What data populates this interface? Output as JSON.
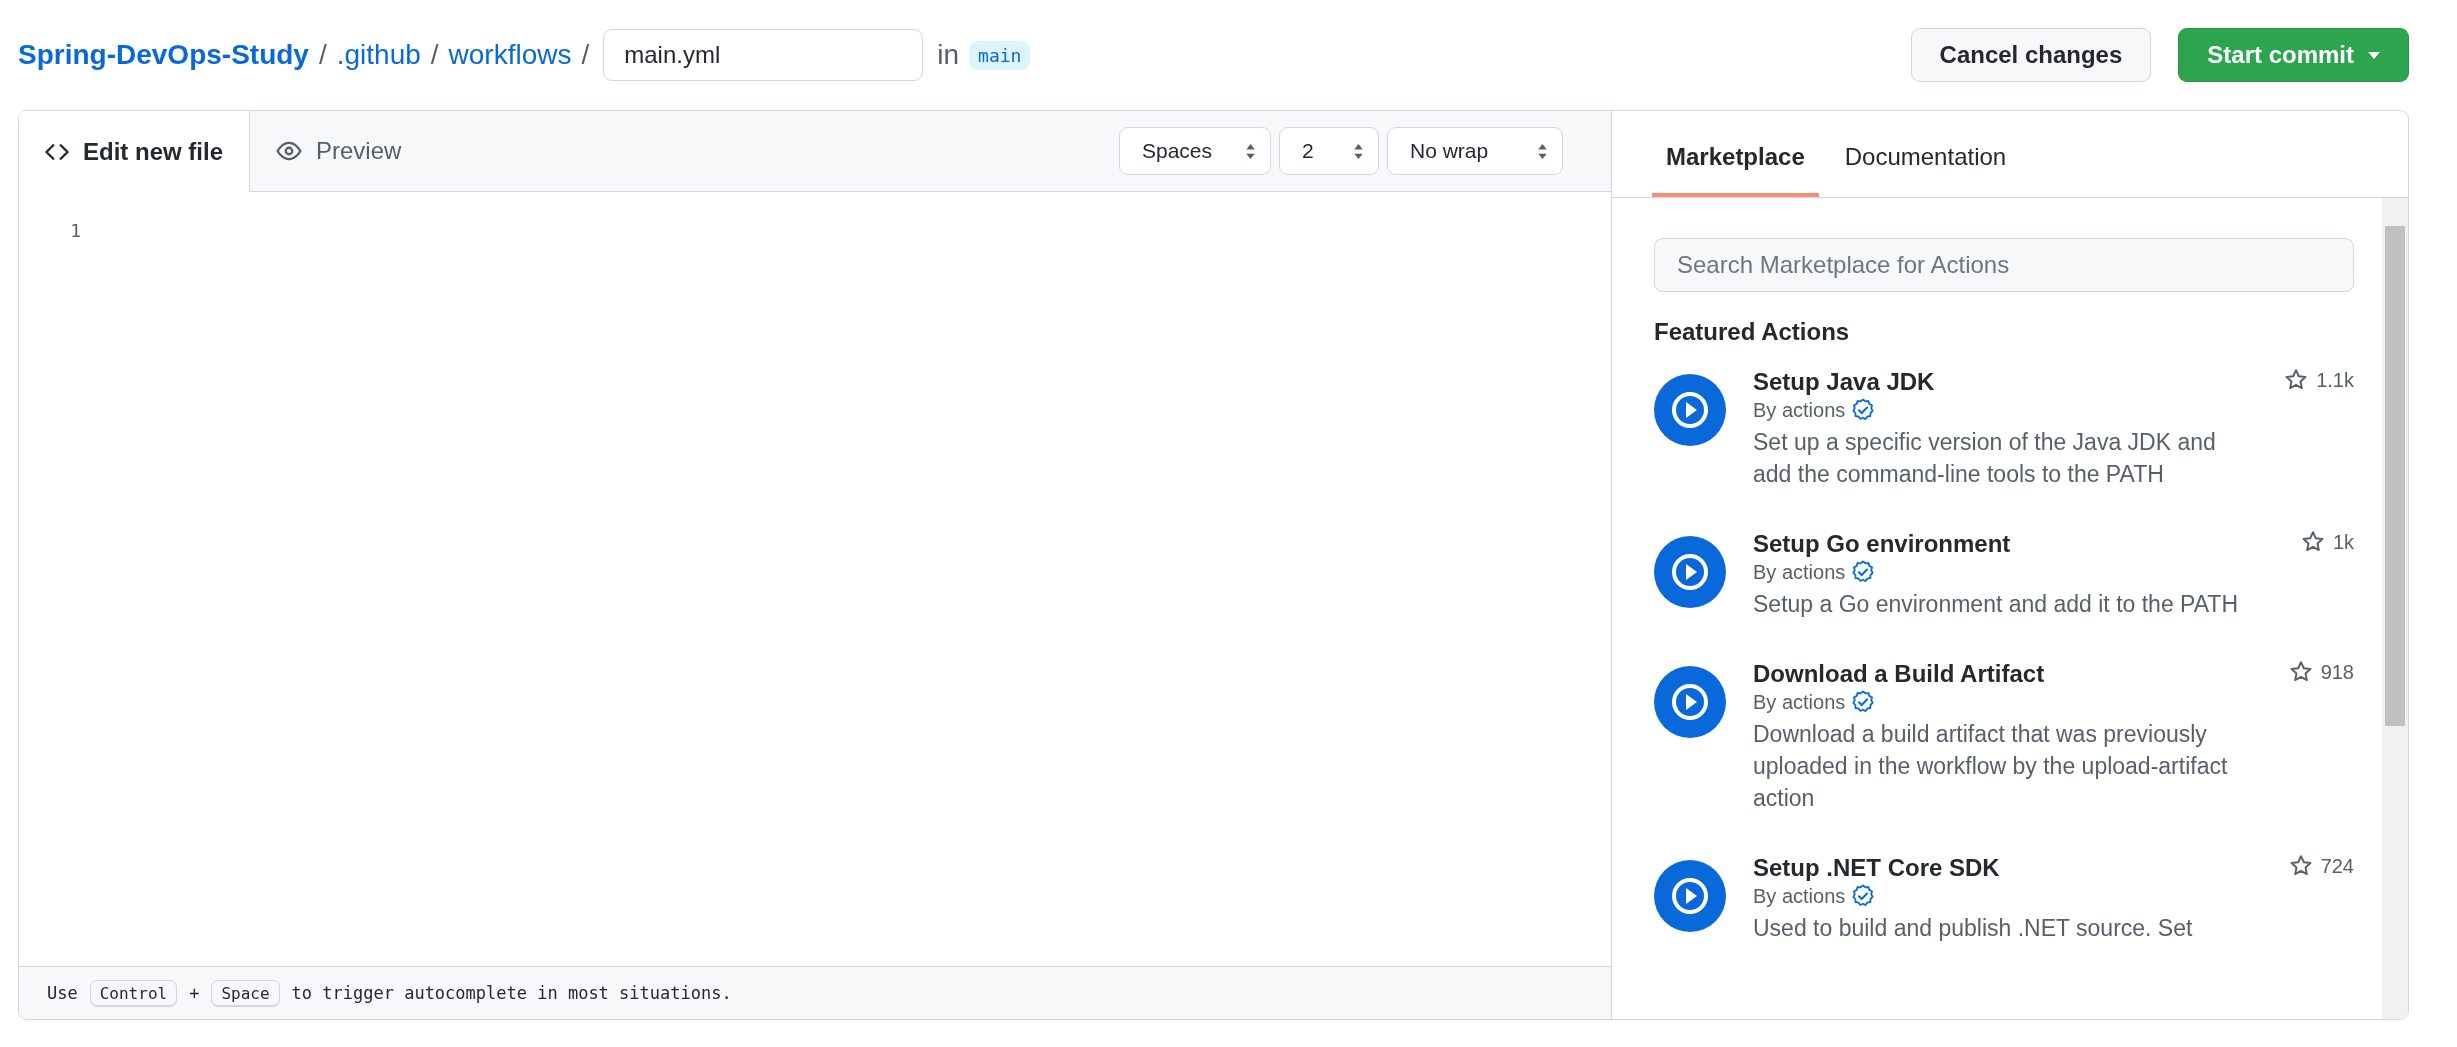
{
  "breadcrumb": {
    "repo": "Spring-DevOps-Study",
    "path": [
      ".github",
      "workflows"
    ],
    "separator": "/",
    "filename": "main.yml",
    "in_label": "in",
    "branch": "main"
  },
  "buttons": [
    {
      "label": "Cancel changes",
      "kind": "secondary"
    },
    {
      "label": "Start commit",
      "kind": "primary"
    }
  ],
  "editor_tabs": [
    {
      "label": "Edit new file",
      "kind": "code",
      "selected": true
    },
    {
      "label": "Preview",
      "kind": "eye",
      "selected": false
    }
  ],
  "editor_options": [
    "Spaces",
    "2",
    "No wrap"
  ],
  "line_numbers": [
    "1"
  ],
  "footer": {
    "prefix": "Use",
    "keys": [
      "Control",
      "Space"
    ],
    "joiner": "+",
    "suffix": "to trigger autocomplete in most situations."
  },
  "sidebar_tabs": [
    {
      "label": "Marketplace",
      "selected": true
    },
    {
      "label": "Documentation",
      "selected": false
    }
  ],
  "search": {
    "placeholder": "Search Marketplace for Actions"
  },
  "featured_title": "Featured Actions",
  "actions": [
    {
      "name": "Setup Java JDK",
      "author": "By actions",
      "verified": true,
      "stars": "1.1k",
      "description": "Set up a specific version of the Java JDK and add the command-line tools to the PATH"
    },
    {
      "name": "Setup Go environment",
      "author": "By actions",
      "verified": true,
      "stars": "1k",
      "description": "Setup a Go environment and add it to the PATH"
    },
    {
      "name": "Download a Build Artifact",
      "author": "By actions",
      "verified": true,
      "stars": "918",
      "description": "Download a build artifact that was previously uploaded in the workflow by the upload-artifact action"
    },
    {
      "name": "Setup .NET Core SDK",
      "author": "By actions",
      "verified": true,
      "stars": "724",
      "description": "Used to build and publish .NET source. Set"
    }
  ]
}
